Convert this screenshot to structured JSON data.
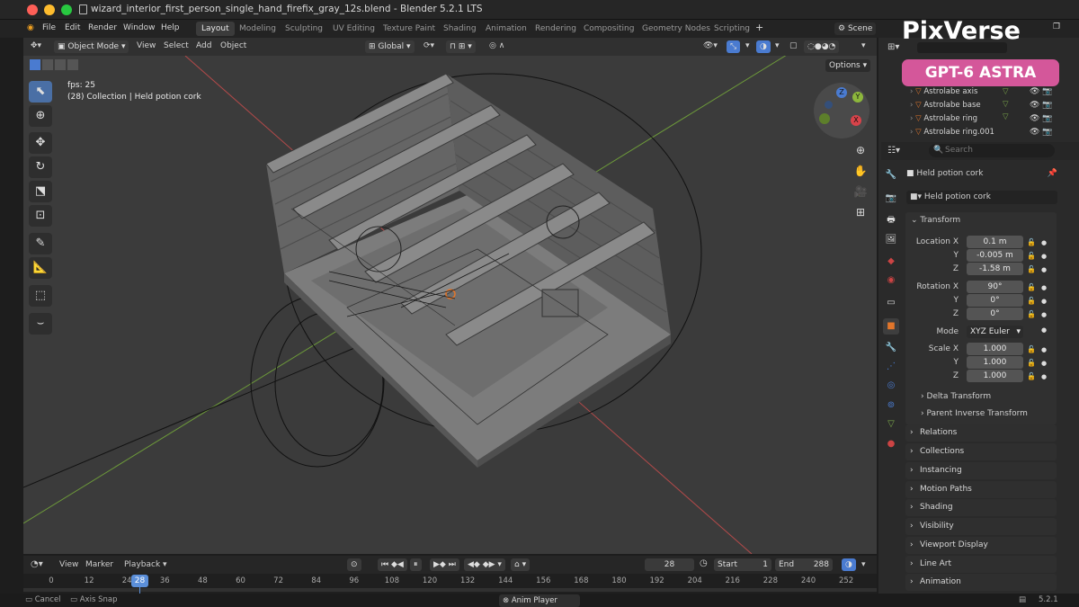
{
  "window": {
    "title": "wizard_interior_first_person_single_hand_firefix_gray_12s.blend - Blender 5.2.1 LTS"
  },
  "menu": [
    "File",
    "Edit",
    "Render",
    "Window",
    "Help"
  ],
  "workspaces": [
    "Layout",
    "Modeling",
    "Sculpting",
    "UV Editing",
    "Texture Paint",
    "Shading",
    "Animation",
    "Rendering",
    "Compositing",
    "Geometry Nodes",
    "Scripting"
  ],
  "active_workspace": "Layout",
  "scene_label": "Scene",
  "watermark": {
    "brand": "PixVerse",
    "badge": "GPT-6 ASTRA"
  },
  "viewport_header": {
    "mode": "Object Mode",
    "menus": [
      "View",
      "Select",
      "Add",
      "Object"
    ],
    "orientation": "Global",
    "options": "Options"
  },
  "overlay": {
    "fps": "fps: 25",
    "collection": "(28) Collection | Held potion cork"
  },
  "gizmo": {
    "z": "Z",
    "y": "Y",
    "x": "X"
  },
  "outliner": {
    "rows": [
      "Astrolabe axis",
      "Astrolabe base",
      "Astrolabe ring",
      "Astrolabe ring.001"
    ]
  },
  "properties": {
    "search_placeholder": "Search",
    "object_name": "Held potion cork",
    "datablock_name": "Held potion cork",
    "transform_title": "Transform",
    "location": {
      "label_x": "Location X",
      "label_y": "Y",
      "label_z": "Z",
      "x": "0.1 m",
      "y": "-0.005 m",
      "z": "-1.58 m"
    },
    "rotation": {
      "label_x": "Rotation X",
      "label_y": "Y",
      "label_z": "Z",
      "x": "90°",
      "y": "0°",
      "z": "0°"
    },
    "mode": {
      "label": "Mode",
      "value": "XYZ Euler"
    },
    "scale": {
      "label_x": "Scale X",
      "label_y": "Y",
      "label_z": "Z",
      "x": "1.000",
      "y": "1.000",
      "z": "1.000"
    },
    "subsections": [
      "Delta Transform",
      "Parent Inverse Transform"
    ],
    "sections": [
      "Relations",
      "Collections",
      "Instancing",
      "Motion Paths",
      "Shading",
      "Visibility",
      "Viewport Display",
      "Line Art",
      "Animation"
    ]
  },
  "timeline": {
    "menus": [
      "View",
      "Marker",
      "Playback"
    ],
    "current_frame": "28",
    "start_label": "Start",
    "start": "1",
    "end_label": "End",
    "end": "288",
    "ticks": [
      "0",
      "12",
      "24",
      "36",
      "48",
      "60",
      "72",
      "84",
      "96",
      "108",
      "120",
      "132",
      "144",
      "156",
      "168",
      "180",
      "192",
      "204",
      "216",
      "228",
      "240",
      "252"
    ]
  },
  "status": {
    "cancel": "Cancel",
    "axis_snap": "Axis Snap",
    "anim_player": "Anim Player",
    "version": "5.2.1"
  },
  "colors": {
    "accent": "#4a7bd0",
    "active_frame": "#5b8fd9",
    "object_orange": "#e2762b"
  }
}
